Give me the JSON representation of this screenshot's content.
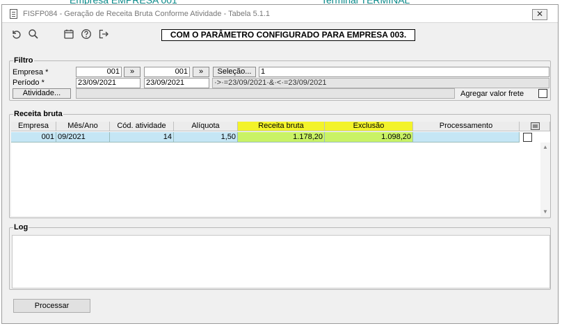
{
  "window": {
    "title": "FISFP084 - Geração de Receita Bruta Conforme Atividade - Tabela 5.1.1",
    "close_label": "✕"
  },
  "toolbar": {
    "banner": "COM O PARÂMETRO CONFIGURADO PARA EMPRESA 003.",
    "icons": [
      "undo-icon",
      "search-icon",
      "calendar-icon",
      "help-icon",
      "exit-icon"
    ]
  },
  "filtro": {
    "legend": "Filtro",
    "empresa_label": "Empresa *",
    "empresa_from": "001",
    "empresa_to": "001",
    "jump_label": "»",
    "selecao_label": "Seleção...",
    "selecao_value": "1",
    "periodo_label": "Período *",
    "periodo_from": "23/09/2021",
    "periodo_to": "23/09/2021",
    "periodo_expr": "·>·=23/09/2021·&·<·=23/09/2021",
    "atividade_label": "Atividade...",
    "atividade_value": "",
    "frete_label": "Agregar valor frete",
    "frete_checked": false
  },
  "receita": {
    "legend": "Receita bruta",
    "columns": [
      "Empresa",
      "Mês/Ano",
      "Cód. atividade",
      "Alíquota",
      "Receita bruta",
      "Exclusão",
      "Processamento"
    ],
    "rows": [
      {
        "empresa": "001",
        "mes_ano": "09/2021",
        "cod_atividade": "14",
        "aliquota": "1,50",
        "receita_bruta": "1.178,20",
        "exclusao": "1.098,20",
        "processamento": ""
      }
    ]
  },
  "log": {
    "legend": "Log",
    "content": ""
  },
  "footer": {
    "processar_label": "Processar"
  },
  "colors": {
    "header_yellow": "#f3f32a",
    "row_blue": "#c5e6f5",
    "row_green": "#c9f266"
  }
}
